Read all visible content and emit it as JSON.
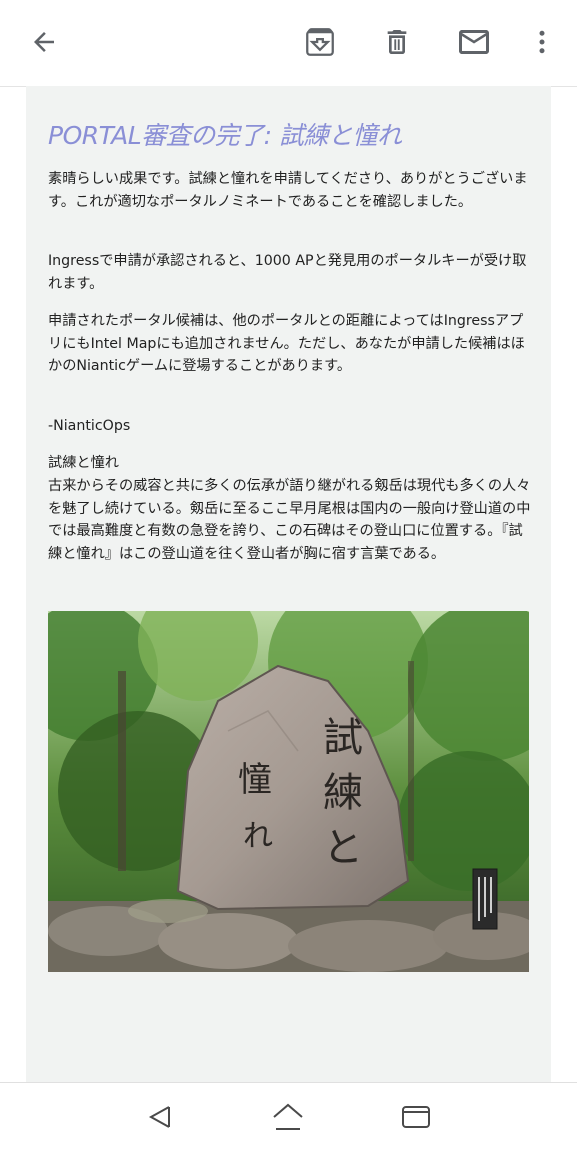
{
  "toolbar": {
    "back_icon": "arrow-back-icon",
    "archive_icon": "archive-icon",
    "delete_icon": "trash-icon",
    "mail_icon": "mail-icon",
    "more_icon": "more-vert-icon"
  },
  "email": {
    "subject": "PORTAL審査の完了: 試練と憧れ",
    "paragraph1": "素晴らしい成果です。試練と憧れを申請してくださり、ありがとうございます。これが適切なポータルノミネートであることを確認しました。",
    "paragraph2": "Ingressで申請が承認されると、1000 APと発見用のポータルキーが受け取れます。",
    "paragraph3": "申請されたポータル候補は、他のポータルとの距離によってはIngressアプリにもIntel Mapにも追加されません。ただし、あなたが申請した候補はほかのNianticゲームに登場することがあります。",
    "signature": "-NianticOps",
    "portal_title": "試練と憧れ",
    "portal_description": "古来からその威容と共に多くの伝承が語り継がれる剱岳は現代も多くの人々を魅了し続けている。剱岳に至るここ早月尾根は国内の一般向け登山道の中では最高難度と有数の急登を誇り、この石碑はその登山口に位置する。『試練と憧れ』はこの登山道を往く登山者が胸に宿す言葉である。",
    "photo": {
      "stone_inscription_right": "試練と",
      "stone_inscription_left": "憧れ"
    }
  },
  "navbar": {
    "back": "nav-back-icon",
    "home": "nav-home-icon",
    "recents": "nav-recents-icon"
  },
  "colors": {
    "subject": "#8a8fd6",
    "panel": "#f1f3f2",
    "icon": "#5f6368"
  }
}
